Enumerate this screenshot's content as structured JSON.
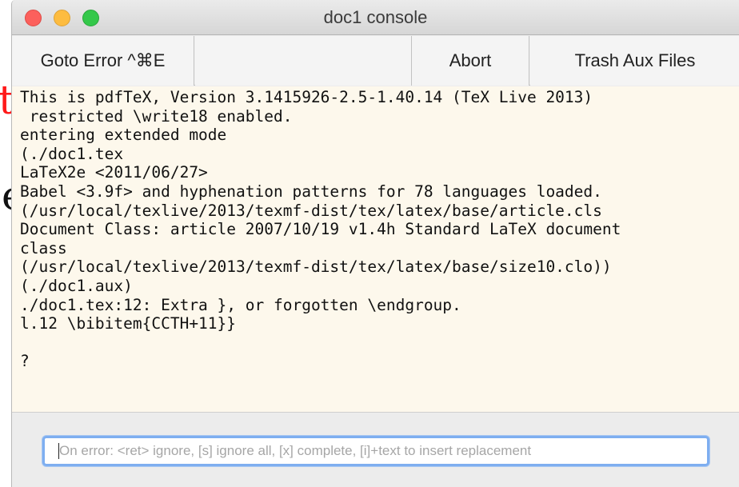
{
  "background_fragments": {
    "red_text": "t",
    "black_text": "e"
  },
  "window": {
    "title": "doc1 console"
  },
  "toolbar": {
    "goto_error_label": "Goto Error ^⌘E",
    "abort_label": "Abort",
    "trash_aux_label": "Trash Aux Files"
  },
  "console": {
    "lines": [
      "This is pdfTeX, Version 3.1415926-2.5-1.40.14 (TeX Live 2013)",
      " restricted \\write18 enabled.",
      "entering extended mode",
      "(./doc1.tex",
      "LaTeX2e <2011/06/27>",
      "Babel <3.9f> and hyphenation patterns for 78 languages loaded.",
      "(/usr/local/texlive/2013/texmf-dist/tex/latex/base/article.cls",
      "Document Class: article 2007/10/19 v1.4h Standard LaTeX document",
      "class",
      "(/usr/local/texlive/2013/texmf-dist/tex/latex/base/size10.clo))",
      "(./doc1.aux)",
      "./doc1.tex:12: Extra }, or forgotten \\endgroup.",
      "l.12 \\bibitem{CCTH+11}}",
      "",
      "?"
    ]
  },
  "input": {
    "placeholder": "On error: <ret> ignore, [s] ignore all, [x] complete, [i]+text to insert replacement",
    "value": ""
  }
}
